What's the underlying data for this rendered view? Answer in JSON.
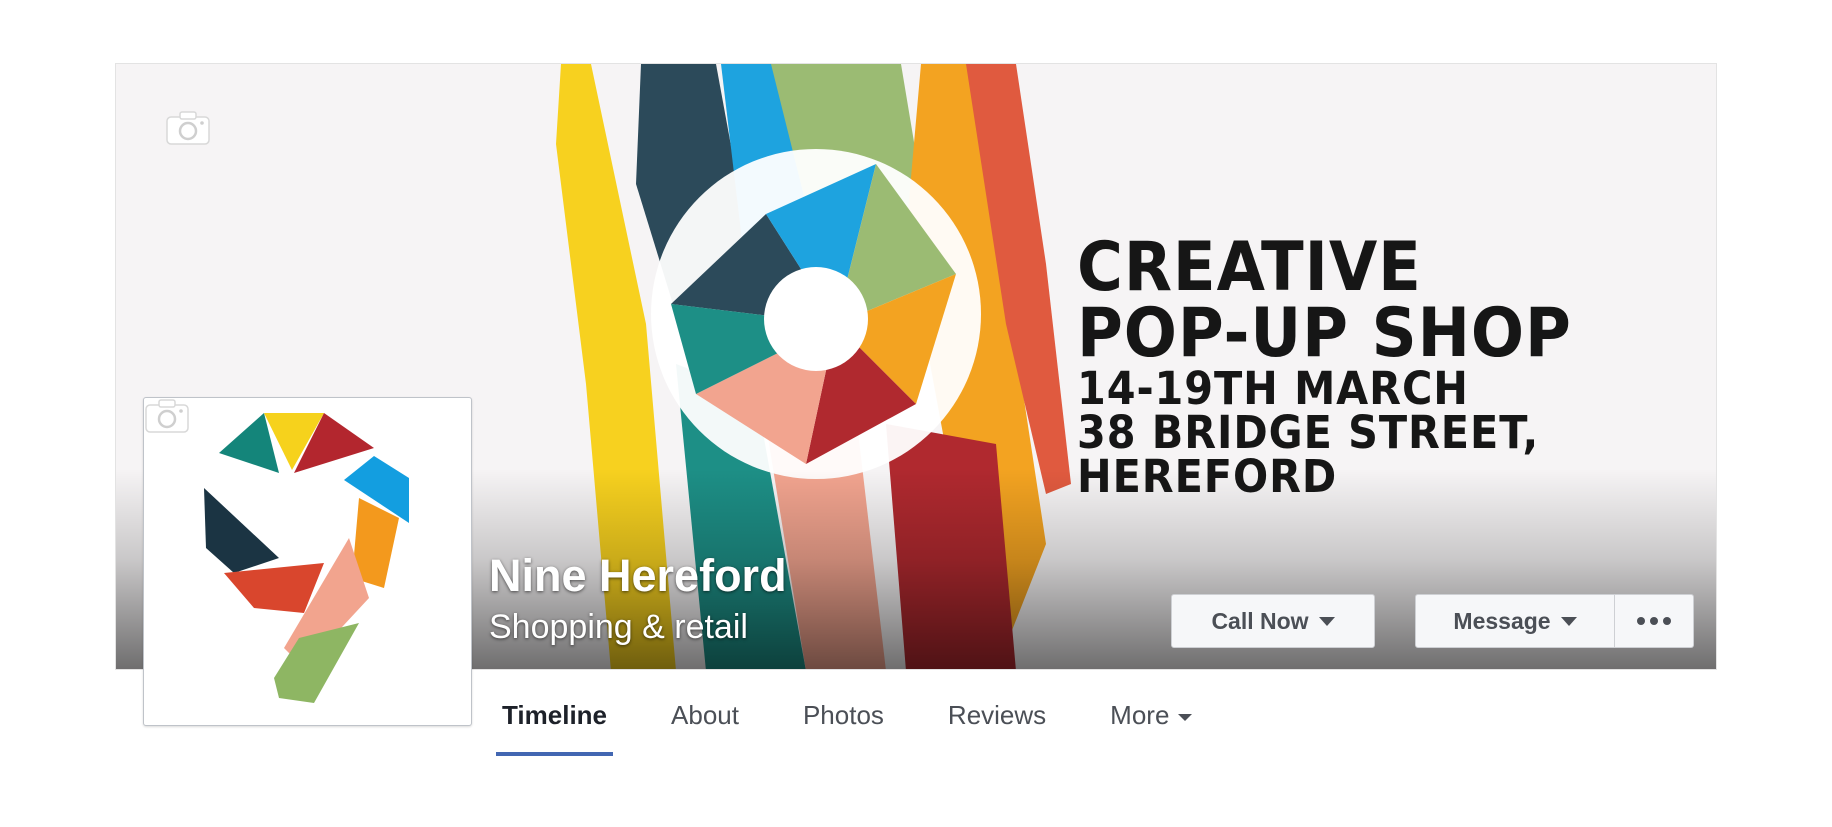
{
  "page": {
    "name": "Nine Hereford",
    "category": "Shopping & retail"
  },
  "cover": {
    "headline_line1": "CREATIVE",
    "headline_line2": "POP-UP SHOP",
    "detail_line1": "14-19TH MARCH",
    "detail_line2": "38 BRIDGE STREET,",
    "detail_line3": "HEREFORD",
    "camera_icon": "camera-icon"
  },
  "actions": {
    "call_label": "Call Now",
    "message_label": "Message",
    "more_icon": "more-dots-icon"
  },
  "tabs": [
    {
      "label": "Timeline",
      "active": true
    },
    {
      "label": "About"
    },
    {
      "label": "Photos"
    },
    {
      "label": "Reviews"
    },
    {
      "label": "More"
    }
  ],
  "colors": {
    "tab_underline": "#4267b2",
    "button_bg": "#f6f7f9",
    "text_dark": "#4b4f56"
  }
}
